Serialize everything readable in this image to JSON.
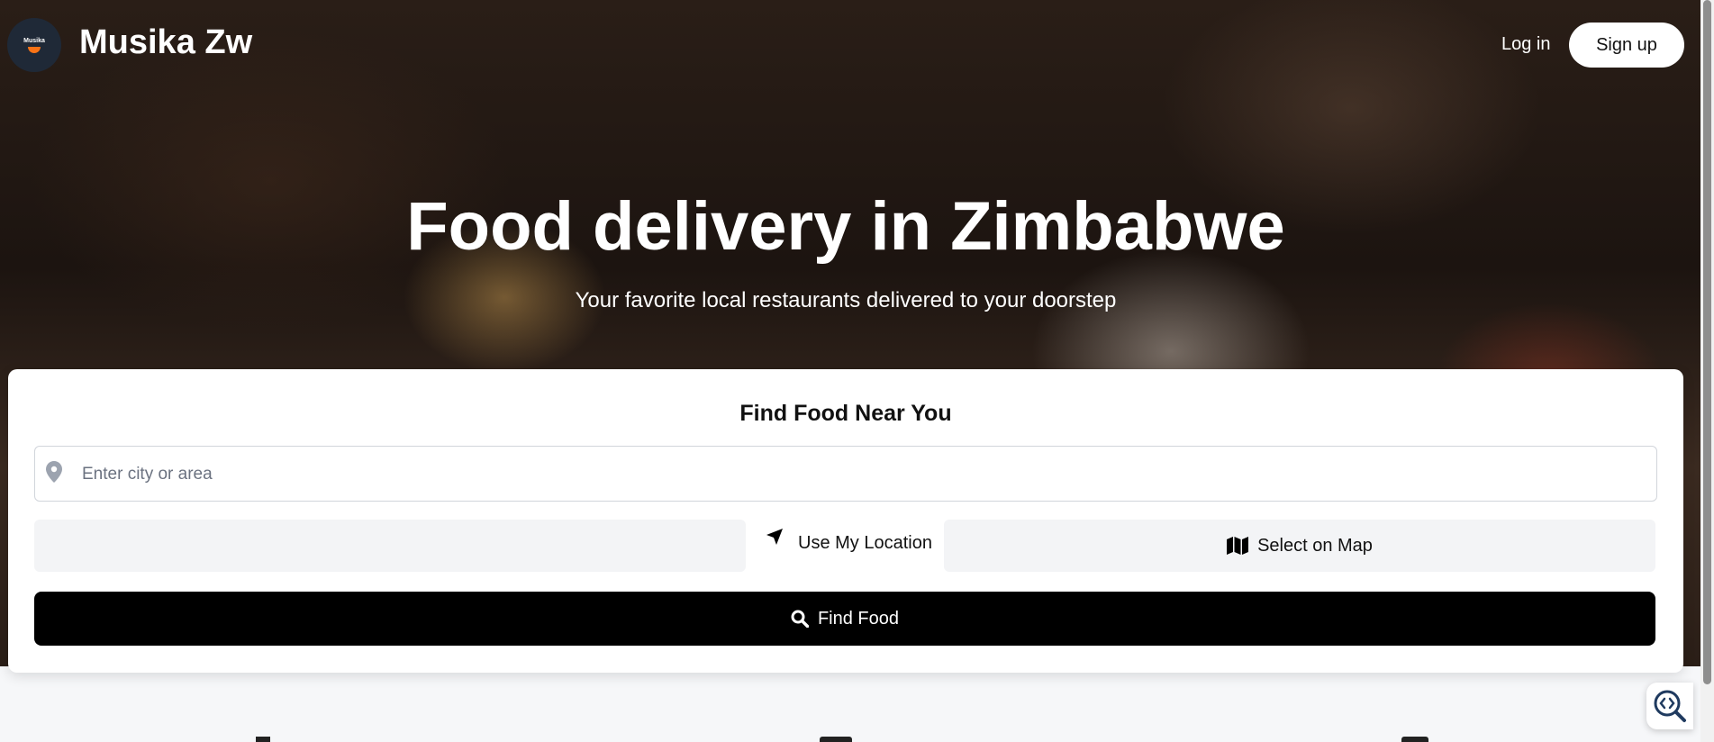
{
  "header": {
    "logo_text": "Musika",
    "brand": "Musika Zw",
    "login_label": "Log in",
    "signup_label": "Sign up"
  },
  "hero": {
    "title": "Food delivery in Zimbabwe",
    "subtitle": "Your favorite local restaurants delivered to your doorstep"
  },
  "search_card": {
    "title": "Find Food Near You",
    "location_input": {
      "value": "",
      "placeholder": "Enter city or area"
    },
    "use_location_label": "Use My Location",
    "select_map_label": "Select on Map",
    "find_food_label": "Find Food"
  },
  "colors": {
    "primary_button": "#000000",
    "secondary_button": "#f3f4f6",
    "logo_bg": "#1f2937",
    "logo_accent": "#f97316"
  },
  "icons": {
    "location": "map-pin-icon",
    "use_location": "navigation-arrow-icon",
    "map": "map-icon",
    "search": "search-icon",
    "floating": "code-search-icon"
  }
}
